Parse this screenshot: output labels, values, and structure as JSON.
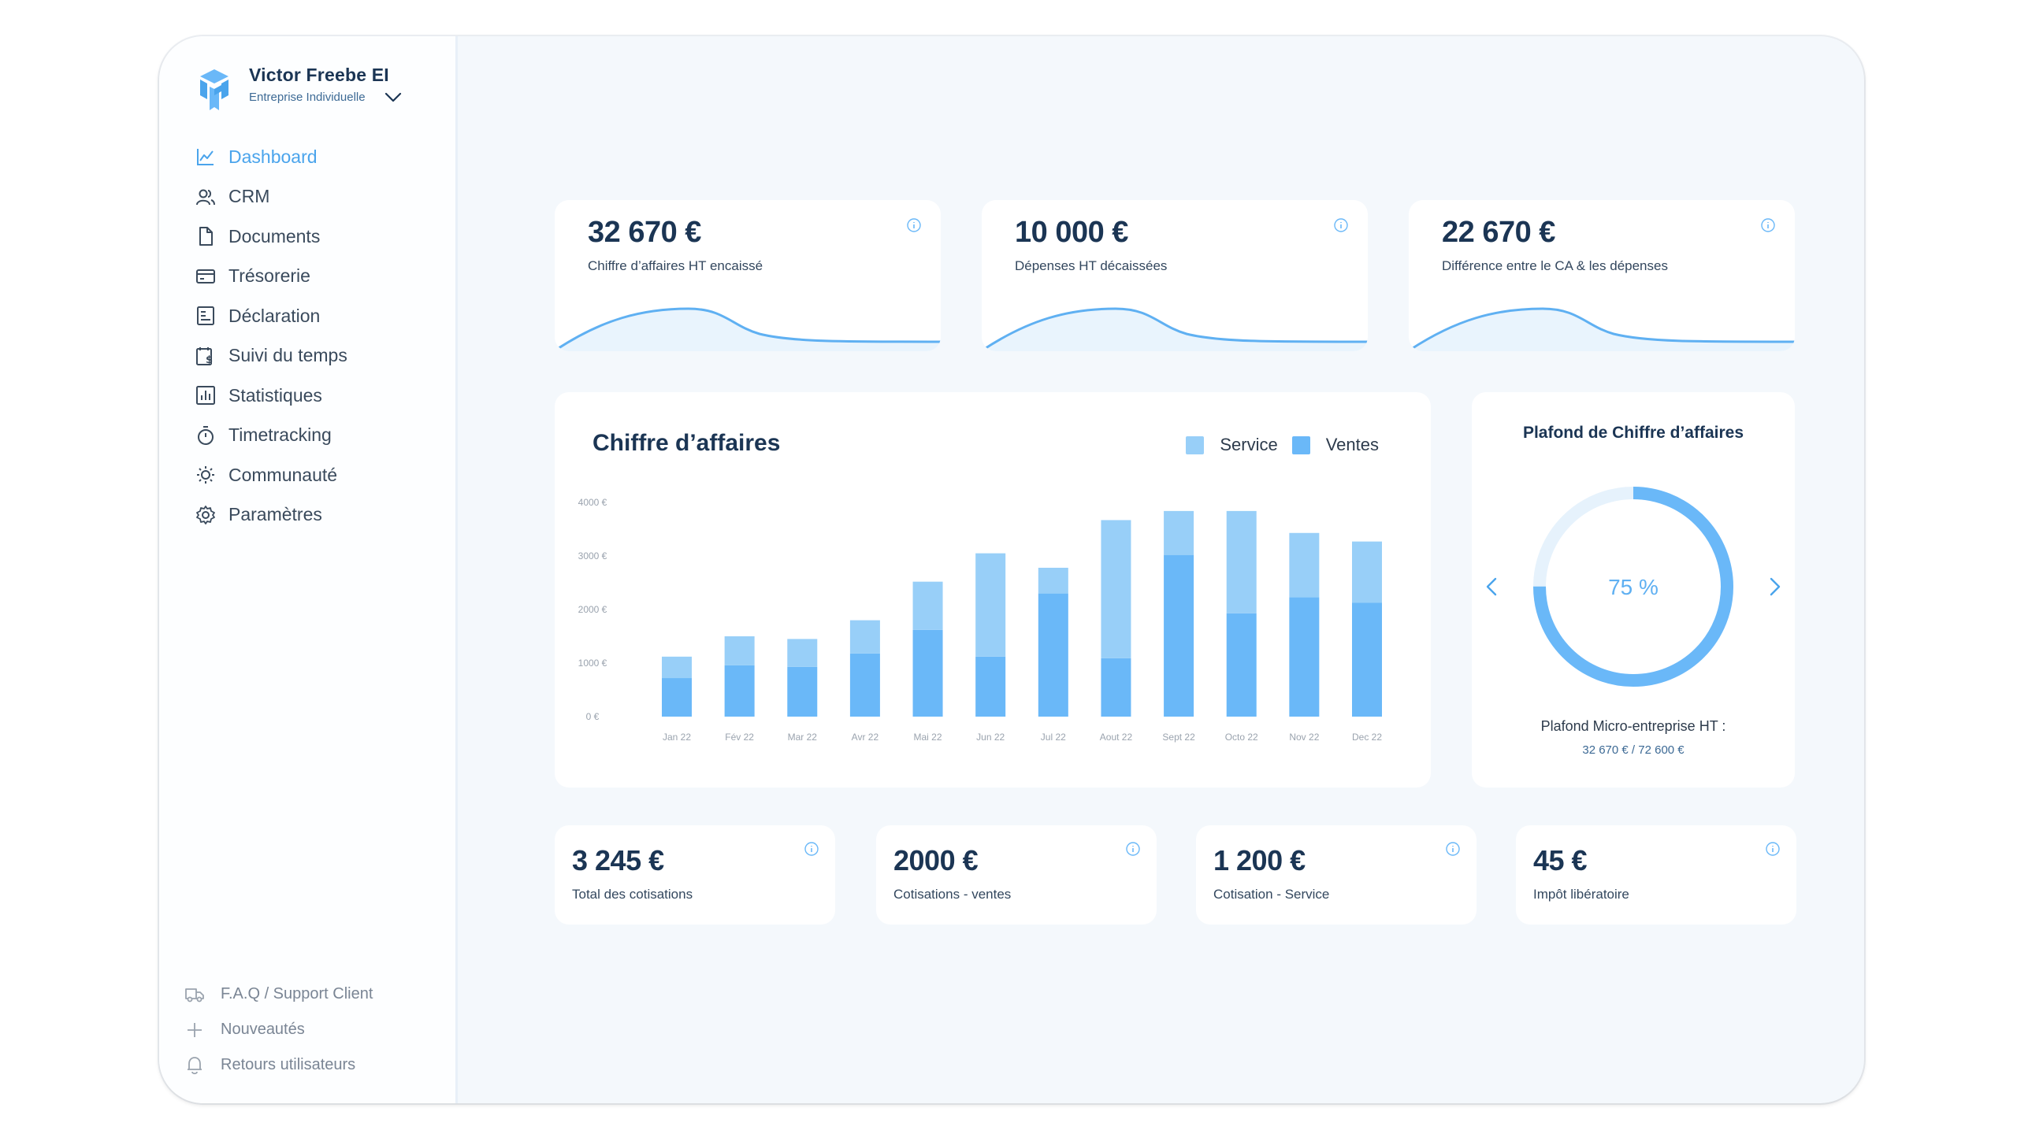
{
  "brand": {
    "name": "Victor Freebe EI",
    "type": "Entreprise Individuelle"
  },
  "nav": [
    {
      "label": "Dashboard",
      "icon": "chart-line-icon",
      "active": true
    },
    {
      "label": "CRM",
      "icon": "users-icon"
    },
    {
      "label": "Documents",
      "icon": "document-icon"
    },
    {
      "label": "Trésorerie",
      "icon": "credit-card-icon"
    },
    {
      "label": "Déclaration",
      "icon": "form-icon"
    },
    {
      "label": "Suivi du temps",
      "icon": "calendar-money-icon"
    },
    {
      "label": "Statistiques",
      "icon": "bar-chart-icon"
    },
    {
      "label": "Timetracking",
      "icon": "stopwatch-icon"
    },
    {
      "label": "Communauté",
      "icon": "sun-icon"
    },
    {
      "label": "Paramètres",
      "icon": "gear-icon"
    }
  ],
  "bottom_nav": [
    {
      "label": "F.A.Q / Support Client",
      "icon": "truck-icon"
    },
    {
      "label": "Nouveautés",
      "icon": "plus-icon"
    },
    {
      "label": "Retours utilisateurs",
      "icon": "bell-icon"
    }
  ],
  "kpis": [
    {
      "value": "32 670 €",
      "label": "Chiffre d’affaires HT encaissé"
    },
    {
      "value": "10 000 €",
      "label": "Dépenses HT décaissées"
    },
    {
      "value": "22 670 €",
      "label": "Différence entre le CA & les dépenses"
    }
  ],
  "revenue_chart": {
    "title": "Chiffre d’affaires",
    "legend": [
      "Service",
      "Ventes"
    ]
  },
  "chart_data": {
    "type": "bar",
    "stacked": true,
    "title": "Chiffre d’affaires",
    "categories": [
      "Jan 22",
      "Fév 22",
      "Mar 22",
      "Avr 22",
      "Mai 22",
      "Jun 22",
      "Jul 22",
      "Aout 22",
      "Sept 22",
      "Octo 22",
      "Nov 22",
      "Dec 22"
    ],
    "series": [
      {
        "name": "Ventes",
        "color": "#6ab8f8",
        "values": [
          720,
          960,
          930,
          1180,
          1620,
          1120,
          2300,
          1090,
          3020,
          1930,
          2230,
          2130
        ]
      },
      {
        "name": "Service",
        "color": "#98cff8",
        "values": [
          400,
          540,
          520,
          620,
          900,
          1930,
          480,
          2580,
          820,
          1910,
          1200,
          1140
        ]
      }
    ],
    "y_ticks": [
      "0 €",
      "1000 €",
      "2000 €",
      "3000 €",
      "4000 €"
    ],
    "ylim": [
      0,
      4000
    ],
    "grid": false,
    "legend_position": "top-right"
  },
  "plafond": {
    "title": "Plafond de Chiffre d’affaires",
    "percent_label": "75 %",
    "progress": 0.75,
    "footer_label": "Plafond Micro-entreprise HT :",
    "footer_value": "32 670 € / 72 600 €"
  },
  "small_stats": [
    {
      "value": "3 245 €",
      "label": "Total des cotisations"
    },
    {
      "value": "2000 €",
      "label": "Cotisations - ventes"
    },
    {
      "value": "1 200 €",
      "label": "Cotisation - Service"
    },
    {
      "value": "45 €",
      "label": "Impôt libératoire"
    }
  ],
  "colors": {
    "accent": "#4aa4ec",
    "ventes": "#6ab8f8",
    "service": "#98cff8",
    "text_dark": "#1b3554"
  }
}
